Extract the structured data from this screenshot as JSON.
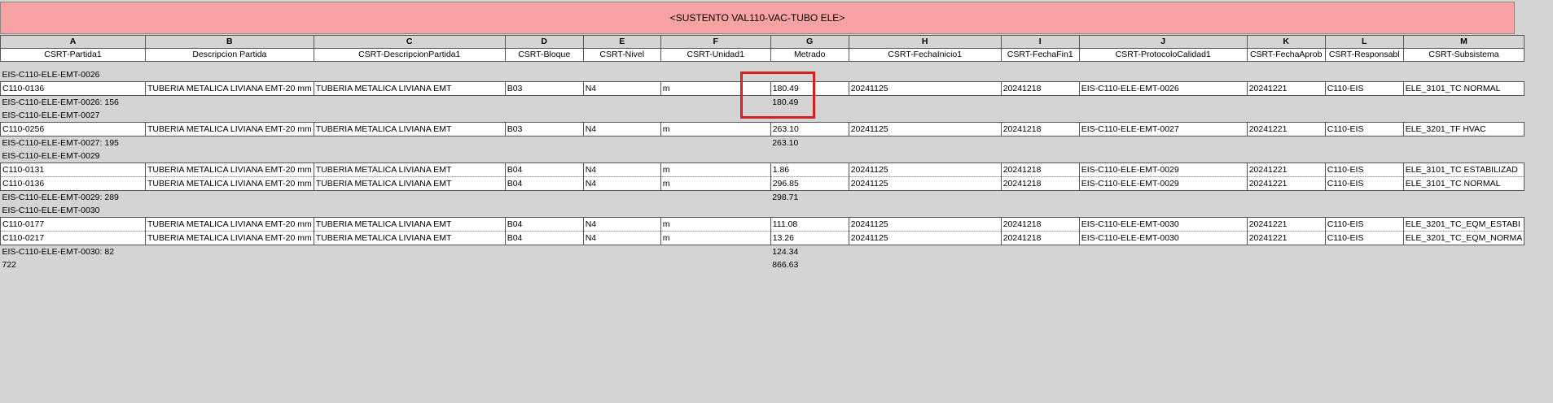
{
  "title": "<SUSTENTO VAL110-VAC-TUBO ELE>",
  "columns": [
    {
      "letter": "A",
      "header": "CSRT-Partida1"
    },
    {
      "letter": "B",
      "header": "Descripcion Partida"
    },
    {
      "letter": "C",
      "header": "CSRT-DescripcionPartida1"
    },
    {
      "letter": "D",
      "header": "CSRT-Bloque"
    },
    {
      "letter": "E",
      "header": "CSRT-Nivel"
    },
    {
      "letter": "F",
      "header": "CSRT-Unidad1"
    },
    {
      "letter": "G",
      "header": "Metrado"
    },
    {
      "letter": "H",
      "header": "CSRT-FechaInicio1"
    },
    {
      "letter": "I",
      "header": "CSRT-FechaFin1"
    },
    {
      "letter": "J",
      "header": "CSRT-ProtocoloCalidad1"
    },
    {
      "letter": "K",
      "header": "CSRT-FechaAprob"
    },
    {
      "letter": "L",
      "header": "CSRT-Responsabl"
    },
    {
      "letter": "M",
      "header": "CSRT-Subsistema"
    }
  ],
  "groups": [
    {
      "name": "EIS-C110-ELE-EMT-0026",
      "rows": [
        [
          "C110-0136",
          "TUBERIA METALICA LIVIANA EMT-20 mm",
          "TUBERIA METALICA LIVIANA EMT",
          "B03",
          "N4",
          "m",
          "180.49",
          "20241125",
          "20241218",
          "EIS-C110-ELE-EMT-0026",
          "20241221",
          "C110-EIS",
          "ELE_3101_TC NORMAL"
        ]
      ],
      "subtotal_label": "EIS-C110-ELE-EMT-0026: 156",
      "subtotal_value": "180.49"
    },
    {
      "name": "EIS-C110-ELE-EMT-0027",
      "rows": [
        [
          "C110-0256",
          "TUBERIA METALICA LIVIANA EMT-20 mm",
          "TUBERIA METALICA LIVIANA EMT",
          "B03",
          "N4",
          "m",
          "263.10",
          "20241125",
          "20241218",
          "EIS-C110-ELE-EMT-0027",
          "20241221",
          "C110-EIS",
          "ELE_3201_TF HVAC"
        ]
      ],
      "subtotal_label": "EIS-C110-ELE-EMT-0027: 195",
      "subtotal_value": "263.10"
    },
    {
      "name": "EIS-C110-ELE-EMT-0029",
      "rows": [
        [
          "C110-0131",
          "TUBERIA METALICA LIVIANA EMT-20 mm",
          "TUBERIA METALICA LIVIANA EMT",
          "B04",
          "N4",
          "m",
          "1.86",
          "20241125",
          "20241218",
          "EIS-C110-ELE-EMT-0029",
          "20241221",
          "C110-EIS",
          "ELE_3101_TC ESTABILIZAD"
        ],
        [
          "C110-0136",
          "TUBERIA METALICA LIVIANA EMT-20 mm",
          "TUBERIA METALICA LIVIANA EMT",
          "B04",
          "N4",
          "m",
          "296.85",
          "20241125",
          "20241218",
          "EIS-C110-ELE-EMT-0029",
          "20241221",
          "C110-EIS",
          "ELE_3101_TC NORMAL"
        ]
      ],
      "subtotal_label": "EIS-C110-ELE-EMT-0029: 289",
      "subtotal_value": "298.71"
    },
    {
      "name": "EIS-C110-ELE-EMT-0030",
      "rows": [
        [
          "C110-0177",
          "TUBERIA METALICA LIVIANA EMT-20 mm",
          "TUBERIA METALICA LIVIANA EMT",
          "B04",
          "N4",
          "m",
          "111.08",
          "20241125",
          "20241218",
          "EIS-C110-ELE-EMT-0030",
          "20241221",
          "C110-EIS",
          "ELE_3201_TC_EQM_ESTABI"
        ],
        [
          "C110-0217",
          "TUBERIA METALICA LIVIANA EMT-20 mm",
          "TUBERIA METALICA LIVIANA EMT",
          "B04",
          "N4",
          "m",
          "13.26",
          "20241125",
          "20241218",
          "EIS-C110-ELE-EMT-0030",
          "20241221",
          "C110-EIS",
          "ELE_3201_TC_EQM_NORMA"
        ]
      ],
      "subtotal_label": "EIS-C110-ELE-EMT-0030: 82",
      "subtotal_value": "124.34"
    }
  ],
  "grand_total_label": "722",
  "grand_total_value": "866.63",
  "colors": {
    "title_bg": "#f8a3a3",
    "highlight": "#d81e1e",
    "background": "#d4d4d4"
  }
}
